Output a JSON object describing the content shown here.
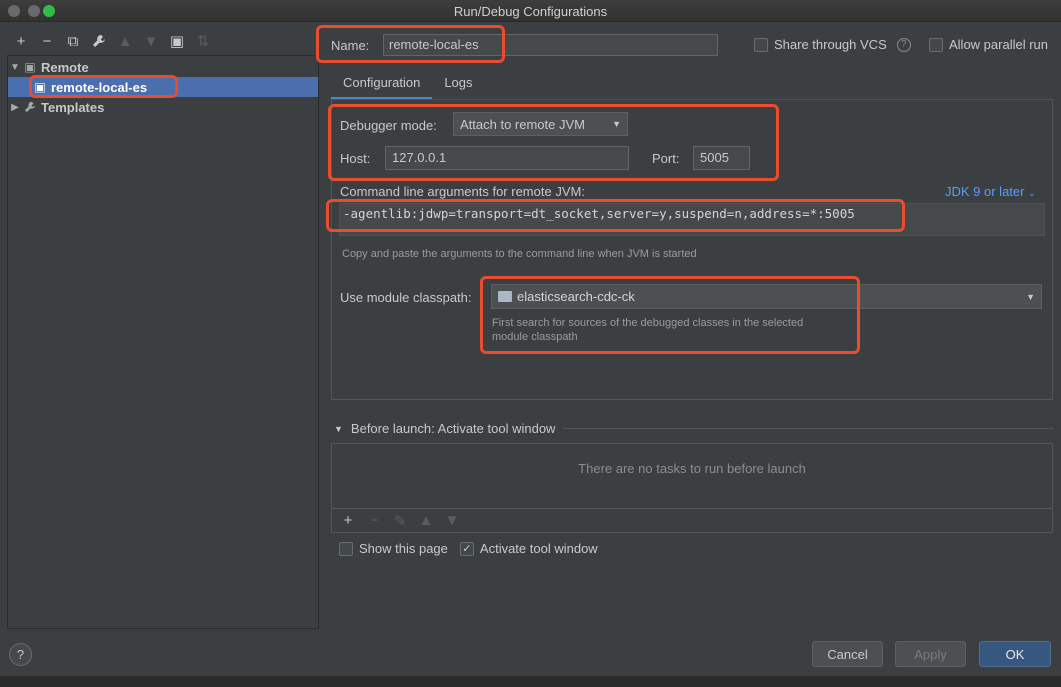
{
  "window": {
    "title": "Run/Debug Configurations"
  },
  "toolbar": {
    "icons": [
      "plus-icon",
      "minus-icon",
      "copy-icon",
      "wrench-icon",
      "arrow-up-icon",
      "arrow-down-icon",
      "folder-add-icon",
      "sort-icon"
    ],
    "glyphs": {
      "add": "+",
      "remove": "−",
      "copy": "⧉",
      "edit": "🔧",
      "up": "▲",
      "down": "▼",
      "folder": "▣",
      "sort": "⇅"
    }
  },
  "tree": {
    "remote_label": "Remote",
    "selected_label": "remote-local-es",
    "templates_label": "Templates"
  },
  "form": {
    "name_label": "Name:",
    "name_value": "remote-local-es",
    "share_label": "Share through VCS",
    "parallel_label": "Allow parallel run",
    "tabs": [
      "Configuration",
      "Logs"
    ],
    "debugger_mode_label": "Debugger mode:",
    "debugger_mode_value": "Attach to remote JVM",
    "host_label": "Host:",
    "host_value": "127.0.0.1",
    "port_label": "Port:",
    "port_value": "5005",
    "cmdline_label": "Command line arguments for remote JVM:",
    "jdk_link": "JDK 9 or later",
    "cmdline_value": "-agentlib:jdwp=transport=dt_socket,server=y,suspend=n,address=*:5005",
    "cmdline_hint": "Copy and paste the arguments to the command line when JVM is started",
    "module_label": "Use module classpath:",
    "module_value": "elasticsearch-cdc-ck",
    "module_hint_1": "First search for sources of the debugged classes in the selected",
    "module_hint_2": "module classpath"
  },
  "before_launch": {
    "title": "Before launch: Activate tool window",
    "empty_text": "There are no tasks to run before launch"
  },
  "options": {
    "show_page_label": "Show this page",
    "show_page_checked": false,
    "activate_label": "Activate tool window",
    "activate_checked": true
  },
  "buttons": {
    "cancel": "Cancel",
    "apply": "Apply",
    "ok": "OK",
    "help": "?"
  },
  "colors": {
    "accent": "#4b6eaf",
    "annotation": "#e94d2d",
    "link": "#589df6",
    "primary_button": "#365880"
  }
}
